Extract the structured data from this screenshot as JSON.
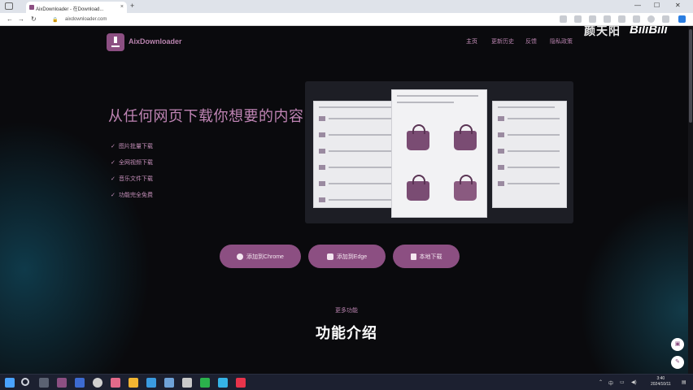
{
  "browser": {
    "tab_title": "AixDownloader - 在Download...",
    "url": "aixdownloader.com",
    "new_tab": "+",
    "close": "×"
  },
  "site": {
    "logo_text": "AixDownloader",
    "nav": [
      "主页",
      "更新历史",
      "反馈",
      "隐私政策"
    ],
    "watermark": "颜天阳",
    "watermark_b": "BiliBili"
  },
  "hero": {
    "title": "从任何网页下载你想要的内容",
    "features": [
      "图片批量下载",
      "全网视频下载",
      "音乐文件下载",
      "功能完全免费"
    ],
    "check_icon": "check-icon"
  },
  "buttons": {
    "chrome": "添加到Chrome",
    "edge": "添加到Edge",
    "download": "本地下载"
  },
  "section": {
    "subtitle": "更多功能",
    "title": "功能介绍"
  },
  "taskbar": {
    "lang": "中",
    "time": "3:40",
    "date": "2024/10/11"
  },
  "colors": {
    "accent": "#8c4f82",
    "accent_text": "#bf84b4",
    "background": "#0a0a0d"
  }
}
